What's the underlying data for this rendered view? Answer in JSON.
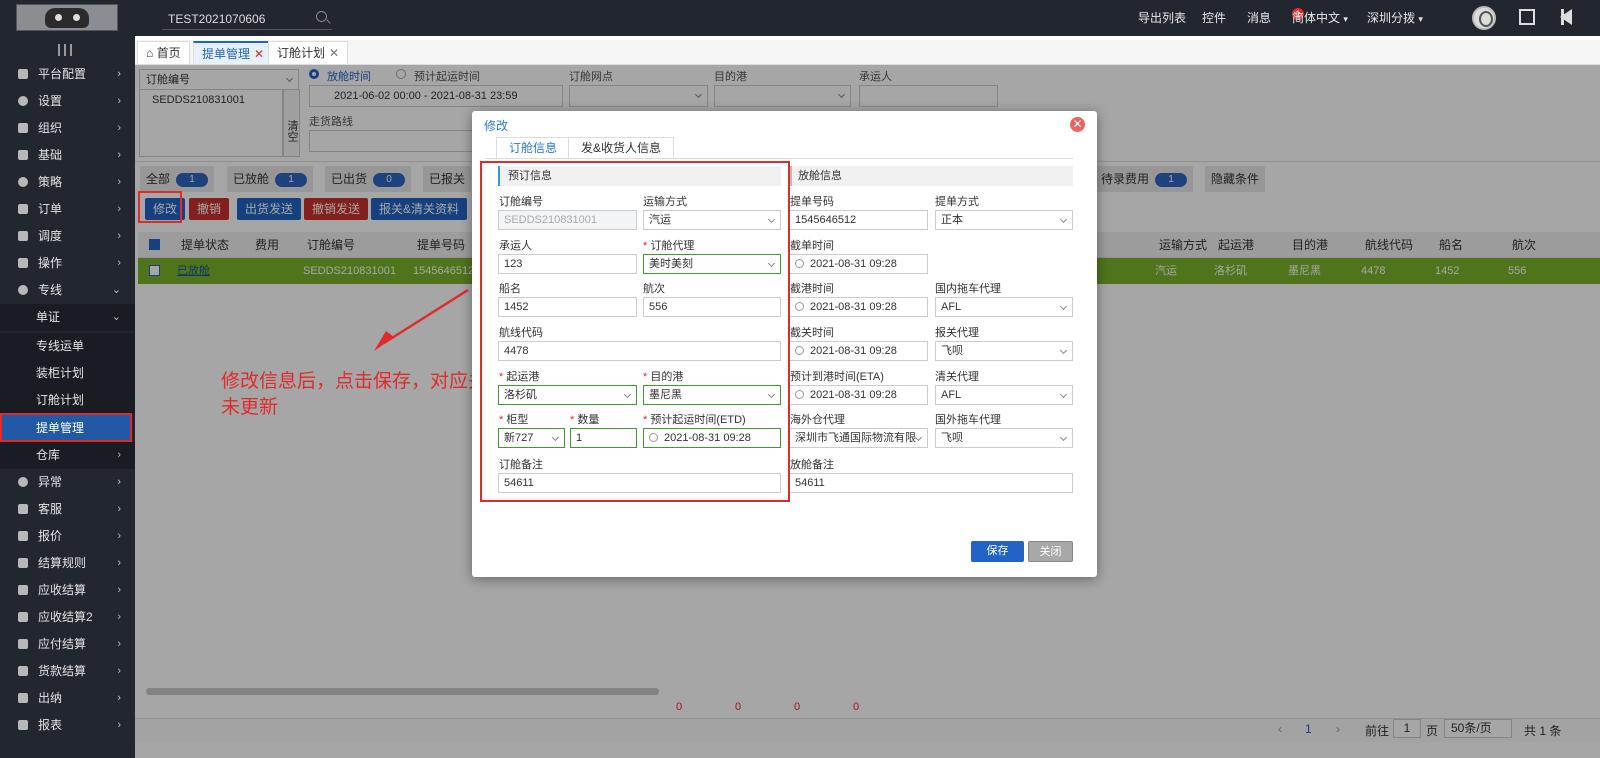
{
  "topbar": {
    "search_value": "TEST2021070606",
    "nav": [
      "导出列表",
      "控件",
      "消息"
    ],
    "message_badge": "1",
    "language": "简体中文",
    "region": "深圳分拨"
  },
  "sidebar": {
    "items": [
      "平台配置",
      "设置",
      "组织",
      "基础",
      "策略",
      "订单",
      "调度",
      "操作",
      "专线"
    ],
    "sub_group": "单证",
    "sub_items": [
      "专线运单",
      "装柜计划",
      "订舱计划",
      "提单管理"
    ],
    "items_after": [
      "仓库",
      "异常",
      "客服",
      "报价",
      "结算规则",
      "应收结算",
      "应收结算2",
      "应付结算",
      "货款结算",
      "出纳",
      "报表"
    ]
  },
  "tabs": {
    "home": "首页",
    "bl_manage": "提单管理",
    "booking_plan": "订舱计划",
    "close": "✕"
  },
  "filters": {
    "booking_no_label": "订舱编号",
    "booking_no_value": "SEDDS210831001",
    "clear": "清空",
    "radio1": "放舱时间",
    "radio2": "预计起运时间",
    "date_range": "2021-06-02 00:00  -  2021-08-31 23:59",
    "point_label": "订舱网点",
    "dest_label": "目的港",
    "carrier_label": "承运人",
    "route_label": "走货路线"
  },
  "chips": [
    {
      "label": "全部",
      "count": "1"
    },
    {
      "label": "已放舱",
      "count": "1"
    },
    {
      "label": "已出货",
      "count": "0"
    },
    {
      "label": "已报关",
      "count": ""
    }
  ],
  "chip_right": {
    "label": "待录费用",
    "count": "1"
  },
  "hide_conditions": "隐藏条件",
  "actions": [
    {
      "label": "修改",
      "color": "#2264c6"
    },
    {
      "label": "撤销",
      "color": "#c9302c"
    },
    {
      "label": "出货发送",
      "color": "#2264c6"
    },
    {
      "label": "撤销发送",
      "color": "#c9302c"
    },
    {
      "label": "报关&清关资料",
      "color": "#2264c6"
    }
  ],
  "table": {
    "headers_left": [
      "提单状态",
      "费用",
      "订舱编号",
      "提单号码"
    ],
    "headers_right": [
      "运输方式",
      "起运港",
      "目的港",
      "航线代码",
      "船名",
      "航次"
    ],
    "row_left": [
      "已放舱",
      "",
      "SEDDS210831001",
      "1545646512"
    ],
    "row_right": [
      "汽运",
      "洛杉矶",
      "墨尼黑",
      "4478",
      "1452",
      "556"
    ],
    "zeros": [
      "0",
      "0",
      "0",
      "0"
    ]
  },
  "pager": {
    "page": "1",
    "goto_label": "前往",
    "goto_value": "1",
    "page_unit": "页",
    "per_page": "50条/页",
    "total": "共 1 条"
  },
  "annotation": "修改信息后，点击保存，对应关系信息未更新",
  "modal": {
    "title": "修改",
    "close": "✕",
    "tab1": "订舱信息",
    "tab2": "发&收货人信息",
    "sect_left": "预订信息",
    "sect_right": "放舱信息",
    "f_booking_no": "订舱编号",
    "v_booking_no": "SEDDS210831001",
    "f_transport": "运输方式",
    "v_transport": "汽运",
    "f_carrier": "承运人",
    "v_carrier": "123",
    "f_agent": "订舱代理",
    "v_agent": "美时美刻",
    "f_ship": "船名",
    "v_ship": "1452",
    "f_voyage": "航次",
    "v_voyage": "556",
    "f_route": "航线代码",
    "v_route": "4478",
    "f_origin": "起运港",
    "v_origin": "洛杉矶",
    "f_dest": "目的港",
    "v_dest": "墨尼黑",
    "f_ctype": "柜型",
    "v_ctype": "新727",
    "f_qty": "数量",
    "v_qty": "1",
    "f_etd": "预计起运时间(ETD)",
    "v_etd": "2021-08-31 09:28",
    "f_remark": "订舱备注",
    "v_remark": "54611",
    "f_bl_no": "提单号码",
    "v_bl_no": "1545646512",
    "f_bl_type": "提单方式",
    "v_bl_type": "正本",
    "f_cut_bl": "截单时间",
    "v_cut_bl": "2021-08-31 09:28",
    "f_cut_port": "截港时间",
    "v_cut_port": "2021-08-31 09:28",
    "f_dom_truck": "国内拖车代理",
    "v_dom_truck": "AFL",
    "f_cut_customs": "截关时间",
    "v_cut_customs": "2021-08-31 09:28",
    "f_customs_agent": "报关代理",
    "v_customs_agent": "飞呗",
    "f_eta": "预计到港时间(ETA)",
    "v_eta": "2021-08-31 09:28",
    "f_clear_agent": "清关代理",
    "v_clear_agent": "AFL",
    "f_overseas": "海外仓代理",
    "v_overseas": "深圳市飞通国际物流有限",
    "f_for_truck": "国外拖车代理",
    "v_for_truck": "飞呗",
    "f_release_remark": "放舱备注",
    "v_release_remark": "54611",
    "save": "保存",
    "close_btn": "关闭"
  }
}
